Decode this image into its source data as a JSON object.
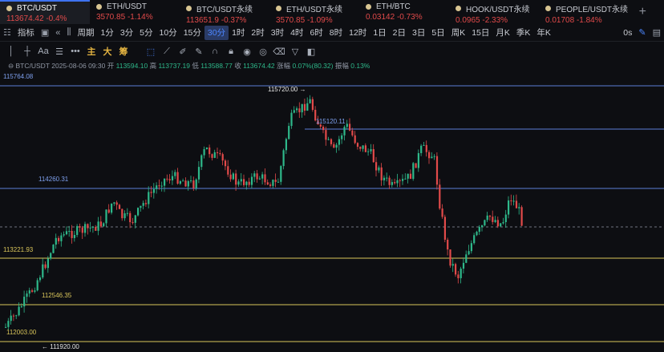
{
  "tabs": [
    {
      "symbol": "BTC/USDT",
      "price": "113674.42",
      "change": "-0.4%",
      "active": true
    },
    {
      "symbol": "ETH/USDT",
      "price": "3570.85",
      "change": "-1.14%"
    },
    {
      "symbol": "BTC/USDT永续",
      "price": "113651.9",
      "change": "-0.37%"
    },
    {
      "symbol": "ETH/USDT永续",
      "price": "3570.85",
      "change": "-1.09%"
    },
    {
      "symbol": "ETH/BTC",
      "price": "0.03142",
      "change": "-0.73%"
    },
    {
      "symbol": "HOOK/USDT永续",
      "price": "0.0965",
      "change": "-2.33%"
    },
    {
      "symbol": "PEOPLE/USDT永续",
      "price": "0.01708",
      "change": "-1.84%"
    }
  ],
  "add_tab": "+",
  "timeframe_bar": {
    "indicator_label": "指标",
    "period_label": "周期",
    "timeframes": [
      "1分",
      "3分",
      "5分",
      "10分",
      "15分",
      "30分",
      "1时",
      "2时",
      "3时",
      "4时",
      "6时",
      "8时",
      "12时",
      "1日",
      "2日",
      "3日",
      "5日",
      "周K",
      "15日",
      "月K",
      "季K",
      "年K"
    ],
    "active": "30分",
    "zero_s": "0s"
  },
  "tools": {
    "main": "主",
    "big": "大",
    "chou": "筹"
  },
  "info_line": {
    "symbol": "BTC/USDT",
    "datetime": "2025-08-06 09:30",
    "open_label": "开",
    "open": "113594.10",
    "high_label": "高",
    "high": "113737.19",
    "low_label": "低",
    "low": "113588.77",
    "close_label": "收",
    "close": "113674.42",
    "change_label": "涨幅",
    "change": "0.07%(80.32)",
    "amp_label": "振幅",
    "amp": "0.13%"
  },
  "price_labels": {
    "top": "115764.08",
    "high_marker": "115720.00 →",
    "line_115120": "115120.11",
    "line_114260": "114260.31",
    "line_113221": "113221.93",
    "line_112546": "112546.35",
    "line_112003": "112003.00",
    "low_marker": "← 111920.00"
  },
  "colors": {
    "up": "#2eb88a",
    "down": "#e24a4a",
    "blue_line": "#5b7fd6",
    "yellow_line": "#d9c55a",
    "active_tab": "#3e73f0"
  }
}
